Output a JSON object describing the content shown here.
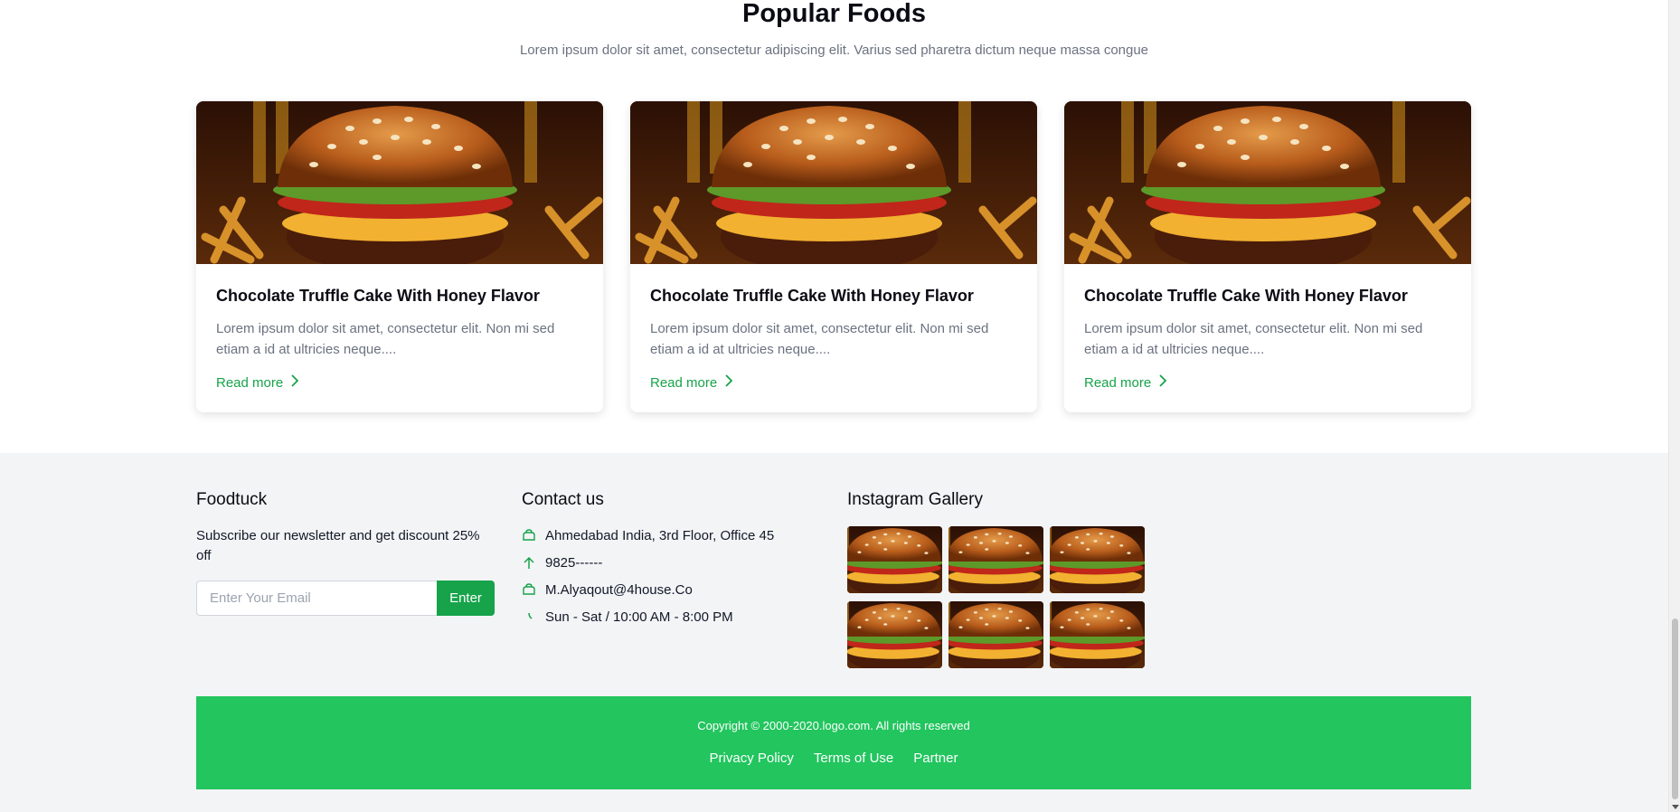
{
  "popular": {
    "title": "Popular Foods",
    "subtitle": "Lorem ipsum dolor sit amet, consectetur adipiscing elit. Varius sed pharetra dictum neque massa congue",
    "cards": [
      {
        "title": "Chocolate Truffle Cake With Honey Flavor",
        "desc": "Lorem ipsum dolor sit amet, consectetur elit. Non mi sed etiam a id at ultricies neque....",
        "link": "Read more"
      },
      {
        "title": "Chocolate Truffle Cake With Honey Flavor",
        "desc": "Lorem ipsum dolor sit amet, consectetur elit. Non mi sed etiam a id at ultricies neque....",
        "link": "Read more"
      },
      {
        "title": "Chocolate Truffle Cake With Honey Flavor",
        "desc": "Lorem ipsum dolor sit amet, consectetur elit. Non mi sed etiam a id at ultricies neque....",
        "link": "Read more"
      }
    ]
  },
  "footer": {
    "brand": {
      "title": "Foodtuck",
      "text": "Subscribe our newsletter and get discount 25% off",
      "email_placeholder": "Enter Your Email",
      "button": "Enter"
    },
    "contact": {
      "title": "Contact us",
      "items": [
        {
          "icon": "home-icon",
          "text": "Ahmedabad India, 3rd Floor, Office 45"
        },
        {
          "icon": "arrow-up-icon",
          "text": "9825------"
        },
        {
          "icon": "home-icon",
          "text": "M.Alyaqout@4house.Co"
        },
        {
          "icon": "clock-icon",
          "text": "Sun - Sat / 10:00 AM - 8:00 PM"
        }
      ]
    },
    "gallery": {
      "title": "Instagram Gallery"
    },
    "copyright": "Copyright © 2000-2020.logo.com. All rights reserved",
    "links": [
      "Privacy Policy",
      "Terms of Use",
      "Partner"
    ]
  },
  "colors": {
    "accent": "#16a34a",
    "bar": "#22c55e",
    "footer_bg": "#f3f4f6"
  }
}
